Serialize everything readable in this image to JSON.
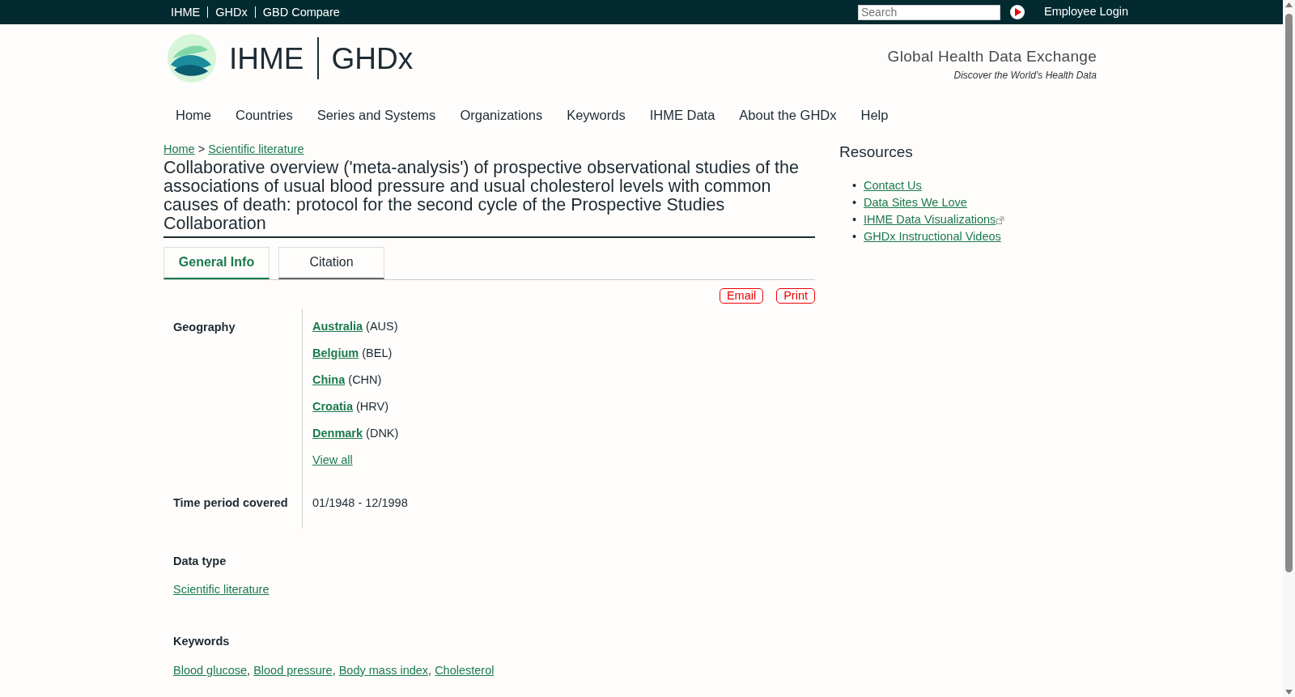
{
  "top_bar": {
    "links": [
      "IHME",
      "GHDx",
      "GBD Compare"
    ],
    "search": {
      "placeholder": "Search"
    },
    "employee_login": "Employee Login"
  },
  "logo": {
    "left": "IHME",
    "right": "GHDx"
  },
  "tagline": {
    "title": "Global Health Data Exchange",
    "subtitle": "Discover the World’s Health Data"
  },
  "nav": [
    "Home",
    "Countries",
    "Series and Systems",
    "Organizations",
    "Keywords",
    "IHME Data",
    "About the GHDx",
    "Help"
  ],
  "breadcrumb": {
    "items": [
      "Home",
      "Scientific literature"
    ],
    "separator": ">"
  },
  "title": "Collaborative overview ('meta-analysis') of prospective observational studies of the associations of usual blood pressure and usual cholesterol levels with common causes of death: protocol for the second cycle of the Prospective Studies Collaboration",
  "tabs": [
    {
      "label": "General Info",
      "selected": true
    },
    {
      "label": "Citation",
      "selected": false
    }
  ],
  "actions": [
    "Email",
    "Print"
  ],
  "geography": {
    "label": "Geography",
    "entries": [
      {
        "name": "Australia",
        "code": "(AUS)"
      },
      {
        "name": "Belgium",
        "code": "(BEL)"
      },
      {
        "name": "China",
        "code": "(CHN)"
      },
      {
        "name": "Croatia",
        "code": "(HRV)"
      },
      {
        "name": "Denmark",
        "code": "(DNK)"
      }
    ],
    "view_all": "View all"
  },
  "time_period": {
    "label": "Time period covered",
    "value": "01/1948 - 12/1998"
  },
  "data_type": {
    "label": "Data type",
    "value": "Scientific literature"
  },
  "keywords": {
    "label": "Keywords",
    "items": [
      "Blood glucose",
      "Blood pressure",
      "Body mass index",
      "Cholesterol"
    ],
    "separator": ","
  },
  "resources": {
    "title": "Resources",
    "marker": "•",
    "items": [
      {
        "label": "Contact Us",
        "external": false
      },
      {
        "label": "Data Sites We Love",
        "external": false
      },
      {
        "label": "IHME Data Visualizations",
        "external": true
      },
      {
        "label": "GHDx Instructional Videos",
        "external": false
      }
    ]
  }
}
